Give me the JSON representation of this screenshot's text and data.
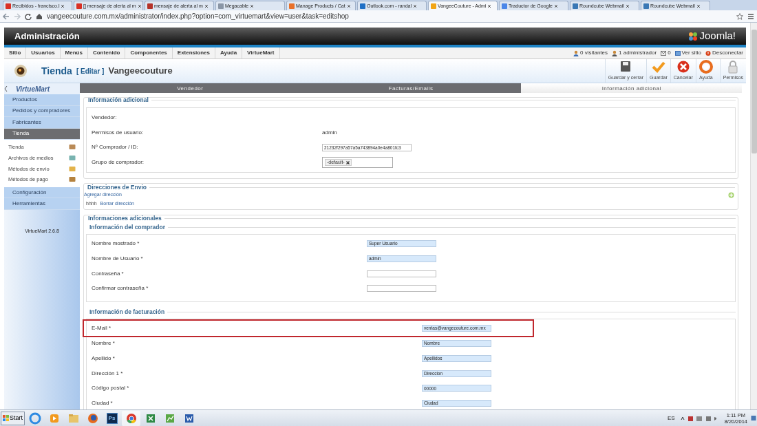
{
  "browser": {
    "tabs": [
      {
        "label": "Recibidos - francisco.l",
        "color": "#d93025",
        "selected": false
      },
      {
        "label": "[] mensaje de alerta al m",
        "color": "#d93025",
        "selected": false
      },
      {
        "label": "mensaje de alerta al m",
        "color": "#b5332a",
        "selected": false
      },
      {
        "label": "Megacable",
        "color": "#8a96a6",
        "selected": false
      },
      {
        "label": "Manage Products / Cat",
        "color": "#e8702a",
        "selected": false
      },
      {
        "label": "Outlook.com - randal",
        "color": "#1f6fc5",
        "selected": false
      },
      {
        "label": "VangeeCouture - Admi",
        "color": "#f2a516",
        "selected": true
      },
      {
        "label": "Traductor de Google",
        "color": "#4a86e8",
        "selected": false
      },
      {
        "label": "Roundcube Webmail",
        "color": "#3a78b5",
        "selected": false
      },
      {
        "label": "Roundcube Webmail",
        "color": "#3a78b5",
        "selected": false
      }
    ],
    "address": "vangeecouture.com.mx/administrator/index.php?option=com_virtuemart&view=user&task=editshop"
  },
  "header": {
    "title": "Administración",
    "logo": "Joomla!"
  },
  "menu": [
    "Sitio",
    "Usuarios",
    "Menús",
    "Contenido",
    "Componentes",
    "Extensiones",
    "Ayuda",
    "VirtueMart"
  ],
  "status": [
    {
      "kind": "visitors",
      "label": "0 visitantes"
    },
    {
      "kind": "admins",
      "label": "1 administrador"
    },
    {
      "kind": "messages",
      "label": "0"
    },
    {
      "kind": "site",
      "label": "Ver sitio"
    },
    {
      "kind": "logout",
      "label": "Desconectar"
    }
  ],
  "toolbar": {
    "title": "Tienda",
    "action": "[ Editar ]",
    "name": "Vangeecouture",
    "buttons": [
      {
        "kind": "save-close",
        "label": "Guardar y cerrar"
      },
      {
        "kind": "save",
        "label": "Guardar"
      },
      {
        "kind": "cancel",
        "label": "Cancelar"
      },
      {
        "kind": "help",
        "label": "Ayuda"
      },
      {
        "kind": "permissions",
        "label": "Permisos"
      }
    ]
  },
  "sidebar": {
    "logo": "VirtueMart",
    "sections": [
      {
        "label": "Productos",
        "selected": false
      },
      {
        "label": "Pedidos y compradores",
        "selected": false
      },
      {
        "label": "Fabricantes",
        "selected": false
      },
      {
        "label": "Tienda",
        "selected": true,
        "children": [
          {
            "label": "Tienda",
            "kind": "store"
          },
          {
            "label": "Archivos de medios",
            "kind": "media"
          },
          {
            "label": "Métodos de envío",
            "kind": "shipping"
          },
          {
            "label": "Métodos de pago",
            "kind": "payment"
          }
        ]
      },
      {
        "label": "Configuración",
        "selected": false
      },
      {
        "label": "Herramientas",
        "selected": false
      }
    ],
    "version": "VirtueMart 2.6.8"
  },
  "tabs": [
    {
      "label": "Vendedor",
      "selected": false
    },
    {
      "label": "Facturas/Emails",
      "selected": false
    },
    {
      "label": "Información adicional",
      "selected": true
    }
  ],
  "info": {
    "legend": "Información adicional",
    "fields": [
      {
        "label": "Vendedor:",
        "kind": "plain"
      },
      {
        "label": "Permisos de usuario:",
        "kind": "plain",
        "value": "admin"
      },
      {
        "label": "Nº Comprador / ID:",
        "kind": "input",
        "value": "21232f297a57a5a743894a0e4a801fc3"
      },
      {
        "label": "Grupo de comprador:",
        "kind": "tags",
        "value": "-default-"
      }
    ]
  },
  "addresses": {
    "legend": "Direcciones de Envio",
    "add_link": "Agregar dirección",
    "entries": [
      {
        "name": "hhhh",
        "delete_link": "Borrar dirección"
      }
    ]
  },
  "more": {
    "legend": "Informaciones adicionales",
    "groups": [
      {
        "legend": "Información del comprador",
        "fields": [
          {
            "label": "Nombre mostrado *",
            "kind": "input",
            "value": "Super Usuario",
            "filled": true
          },
          {
            "label": "Nombre de Usuario *",
            "kind": "input",
            "value": "admin",
            "filled": true
          },
          {
            "label": "Contraseña *",
            "kind": "input",
            "filled": false
          },
          {
            "label": "Confirmar contraseña *",
            "kind": "input",
            "filled": false
          }
        ]
      },
      {
        "legend": "Información de facturación",
        "fields": [
          {
            "label": "E-Mail *",
            "kind": "input",
            "value": "ventas@vangecouture.com.mx",
            "filled": true,
            "highlighted": true
          },
          {
            "label": "Nombre *",
            "kind": "input",
            "value": "Nombre",
            "filled": true
          },
          {
            "label": "Apellido *",
            "kind": "input",
            "value": "Apellidos",
            "filled": true
          },
          {
            "label": "Dirección 1 *",
            "kind": "input",
            "value": "Direccion",
            "filled": true
          },
          {
            "label": "Código postal *",
            "kind": "input",
            "value": "00000",
            "filled": true
          },
          {
            "label": "Ciudad *",
            "kind": "input",
            "value": "Ciudad",
            "filled": true
          }
        ]
      }
    ]
  },
  "taskbar": {
    "start": "Start",
    "apps": [
      {
        "kind": "ie"
      },
      {
        "kind": "media"
      },
      {
        "kind": "folder"
      },
      {
        "kind": "firefox"
      },
      {
        "kind": "photoshop",
        "label": "Ps"
      },
      {
        "kind": "chrome"
      },
      {
        "kind": "excel"
      },
      {
        "kind": "project"
      },
      {
        "kind": "word"
      }
    ],
    "language": "ES",
    "time": "1:11 PM",
    "date": "8/20/2014"
  }
}
